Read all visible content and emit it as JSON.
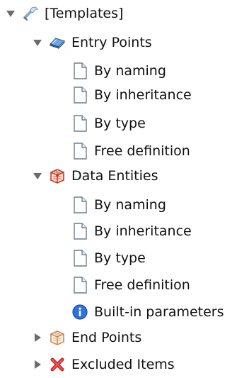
{
  "tree": {
    "templates": {
      "label": "[Templates]",
      "icon": "wrench-icon"
    },
    "entry_points": {
      "label": "Entry Points",
      "icon": "book-icon",
      "children": [
        {
          "label": "By naming",
          "icon": "document-icon"
        },
        {
          "label": "By inheritance",
          "icon": "document-icon"
        },
        {
          "label": "By type",
          "icon": "document-icon"
        },
        {
          "label": "Free definition",
          "icon": "document-icon"
        }
      ]
    },
    "data_entities": {
      "label": "Data Entities",
      "icon": "entity-cube-icon",
      "children": [
        {
          "label": "By naming",
          "icon": "document-icon"
        },
        {
          "label": "By inheritance",
          "icon": "document-icon"
        },
        {
          "label": "By type",
          "icon": "document-icon"
        },
        {
          "label": "Free definition",
          "icon": "document-icon"
        },
        {
          "label": "Built-in parameters",
          "icon": "info-icon"
        }
      ]
    },
    "end_points": {
      "label": "End Points",
      "icon": "end-points-cube-icon"
    },
    "excluded_items": {
      "label": "Excluded Items",
      "icon": "red-x-icon"
    }
  },
  "colors": {
    "toggle": "#6b6b6b",
    "document": "#6f7d90",
    "info": "#2f73d9",
    "excluded": "#d72a2a",
    "entity": "#bf3b2b",
    "book": "#4a87c4"
  }
}
